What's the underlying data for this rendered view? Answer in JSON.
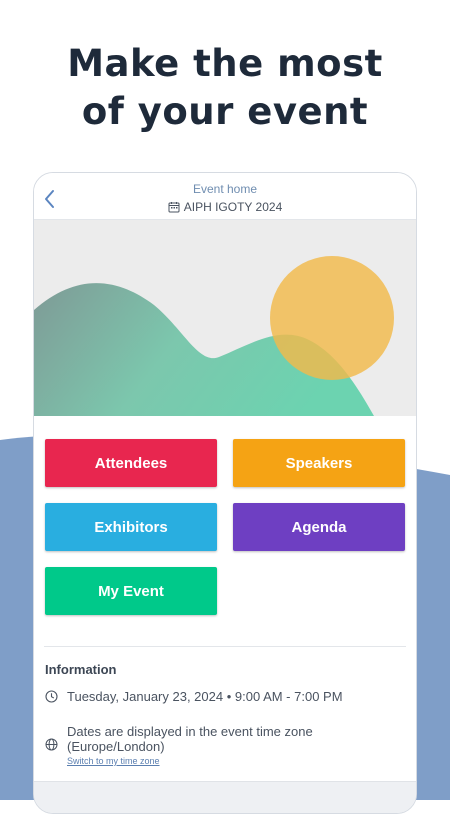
{
  "headline": {
    "line1": "Make the most",
    "line2": "of your event"
  },
  "header": {
    "title": "Event home",
    "event_name": "AIPH IGOTY 2024"
  },
  "tiles": [
    {
      "label": "Attendees",
      "color": "#e8264f"
    },
    {
      "label": "Speakers",
      "color": "#f5a314"
    },
    {
      "label": "Exhibitors",
      "color": "#29aee0"
    },
    {
      "label": "Agenda",
      "color": "#6e3fc2"
    },
    {
      "label": "My Event",
      "color": "#00c98a"
    }
  ],
  "information": {
    "title": "Information",
    "datetime": "Tuesday, January 23, 2024 • 9:00 AM - 7:00 PM",
    "timezone_note_line1": "Dates are displayed in the event time zone",
    "timezone_note_line2": "(Europe/London)",
    "switch_link": "Switch to my time zone"
  },
  "colors": {
    "background_shape": "#7f9ec8",
    "headline": "#1e2a3a",
    "hero_bg": "#ececec",
    "hero_circle": "#f2b94a",
    "hero_wave": "#6cd3b0"
  }
}
